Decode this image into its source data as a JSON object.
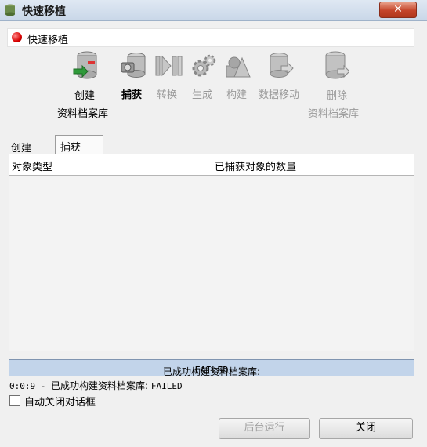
{
  "window": {
    "title": "快速移植",
    "close_glyph": "✕"
  },
  "header": {
    "text": "快速移植"
  },
  "steps": [
    {
      "line1": "创建",
      "line2": "资料档案库",
      "state": "normal",
      "icon": "database-create-icon"
    },
    {
      "line1": "捕获",
      "line2": "",
      "state": "active",
      "icon": "camera-database-icon"
    },
    {
      "line1": "转换",
      "line2": "",
      "state": "disabled",
      "icon": "convert-arrows-icon"
    },
    {
      "line1": "生成",
      "line2": "",
      "state": "disabled",
      "icon": "gears-icon"
    },
    {
      "line1": "构建",
      "line2": "",
      "state": "disabled",
      "icon": "build-shapes-icon"
    },
    {
      "line1": "数据移动",
      "line2": "",
      "state": "disabled",
      "icon": "data-move-icon"
    },
    {
      "line1": "删除",
      "line2": "资料档案库",
      "state": "disabled",
      "icon": "database-delete-icon"
    }
  ],
  "tabs": [
    {
      "label": "创建"
    },
    {
      "label": "捕获"
    }
  ],
  "table": {
    "columns": [
      "对象类型",
      "已捕获对象的数量"
    ],
    "rows": []
  },
  "status": {
    "prefix": "已成功构建资料档案库: ",
    "result": "FAILED"
  },
  "log": {
    "time": "0:0:9",
    "sep": " - ",
    "message": "已成功构建资料档案库: ",
    "result": "FAILED"
  },
  "options": {
    "auto_close_label": "自动关闭对话框",
    "auto_close_checked": false
  },
  "buttons": {
    "run_background": "后台运行",
    "close": "关闭"
  }
}
